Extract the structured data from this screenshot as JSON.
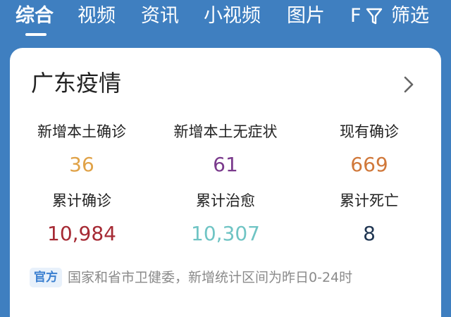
{
  "tabs": [
    {
      "label": "综合",
      "active": true
    },
    {
      "label": "视频",
      "active": false
    },
    {
      "label": "资讯",
      "active": false
    },
    {
      "label": "小视频",
      "active": false
    },
    {
      "label": "图片",
      "active": false
    },
    {
      "label": "F",
      "active": false
    },
    {
      "label": "筛选",
      "active": false
    }
  ],
  "card": {
    "title": "广东疫情",
    "stats": [
      {
        "label": "新增本土确诊",
        "value": "36",
        "color": "#e0a247"
      },
      {
        "label": "新增本土无症状",
        "value": "61",
        "color": "#7a3a8c"
      },
      {
        "label": "现有确诊",
        "value": "669",
        "color": "#d0783a"
      },
      {
        "label": "累计确诊",
        "value": "10,984",
        "color": "#a62a34"
      },
      {
        "label": "累计治愈",
        "value": "10,307",
        "color": "#6fc4c4"
      },
      {
        "label": "累计死亡",
        "value": "8",
        "color": "#1f3551"
      }
    ],
    "source_badge": "官方",
    "source_text": "国家和省市卫健委，新增统计区间为昨日0-24时"
  },
  "colors": {
    "header_bg": "#3f7fc0",
    "badge_bg": "#e8f1fb",
    "badge_text": "#3a7fd0"
  }
}
